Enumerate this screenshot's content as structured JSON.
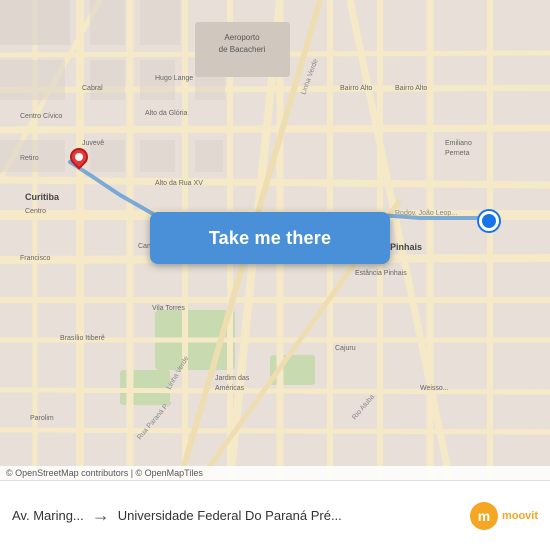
{
  "map": {
    "attribution": "© OpenStreetMap contributors | © OpenMapTiles",
    "center_lat": -25.45,
    "center_lng": -49.27
  },
  "button": {
    "label": "Take me there"
  },
  "bottom_bar": {
    "from_label": "Av. Maring...",
    "arrow": "→",
    "to_label": "Universidade Federal Do Paraná Pré...",
    "logo_text": "moovit"
  },
  "markers": {
    "origin_color": "#1a73e8",
    "destination_color": "#e53935"
  }
}
